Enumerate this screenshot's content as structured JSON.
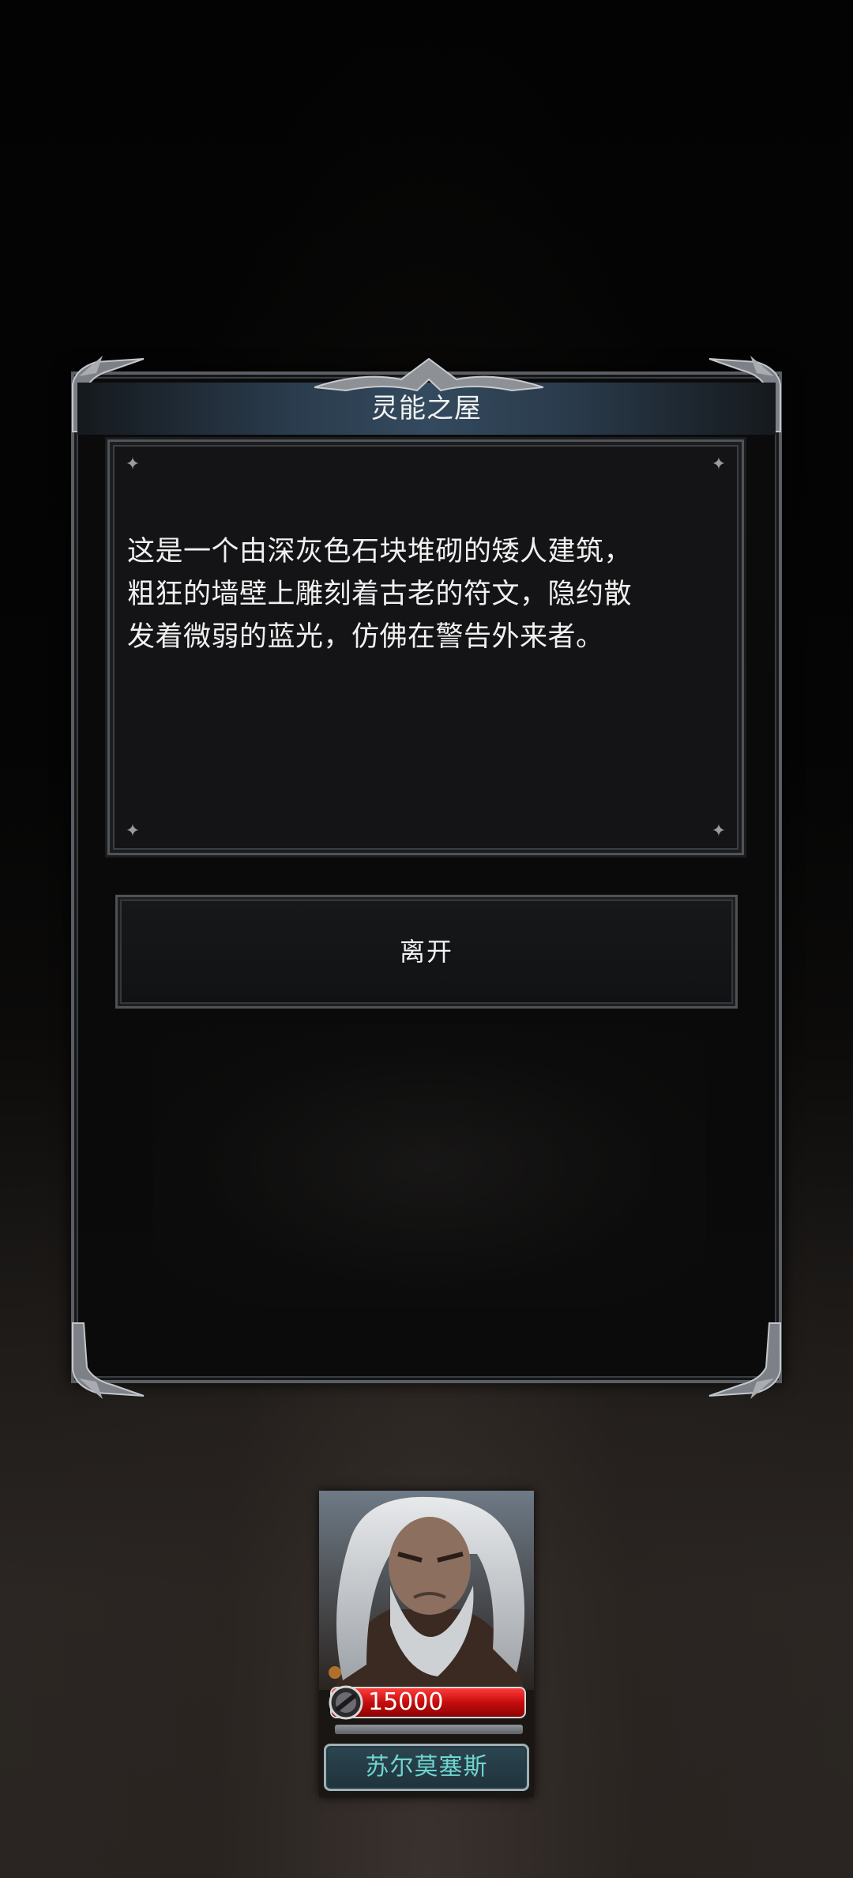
{
  "dialog": {
    "title": "灵能之屋",
    "description_lines": [
      "这是一个由深灰色石块堆砌的矮人建筑，",
      "粗狂的墙壁上雕刻着古老的符文，隐约散",
      "发着微弱的蓝光，仿佛在警告外来者。"
    ],
    "leave_label": "离开"
  },
  "hero": {
    "power": "15000",
    "name": "苏尔莫塞斯",
    "power_icon": "power-gauge-icon"
  },
  "colors": {
    "title_bar": "#344a5e",
    "power_bar": "#c60d0d",
    "name_text": "#6fd5cf",
    "name_plate": "#2c4550"
  }
}
